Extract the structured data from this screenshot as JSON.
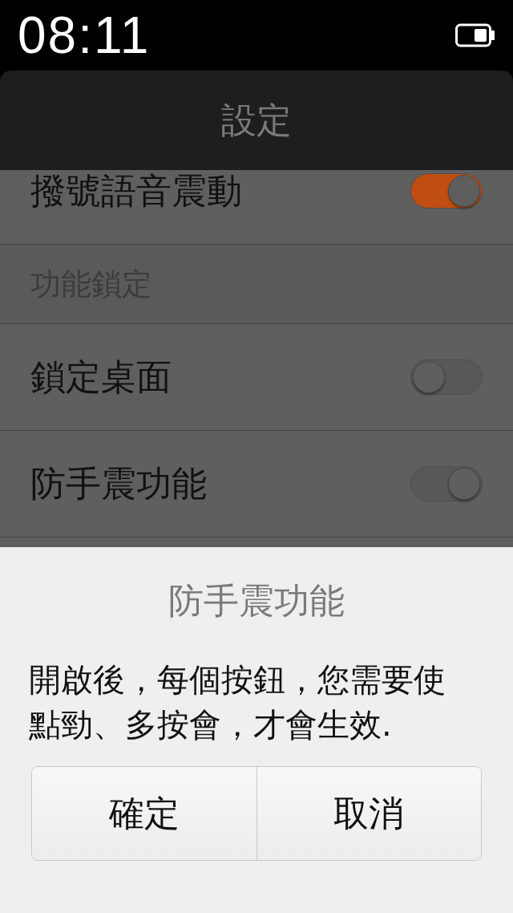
{
  "status_bar": {
    "time": "08:11"
  },
  "header": {
    "title": "設定"
  },
  "settings": [
    {
      "kind": "toggle",
      "label": "撥號語音震動",
      "on": true,
      "highlighted": true
    },
    {
      "kind": "section",
      "label": "功能鎖定"
    },
    {
      "kind": "toggle",
      "label": "鎖定桌面",
      "on": false,
      "highlighted": false
    },
    {
      "kind": "toggle",
      "label": "防手震功能",
      "on": true,
      "highlighted": false
    }
  ],
  "dialog": {
    "title": "防手震功能",
    "message": "開啟後，每個按鈕，您需要使點勁、多按會，才會生效.",
    "buttons": [
      "確定",
      "取消"
    ]
  }
}
